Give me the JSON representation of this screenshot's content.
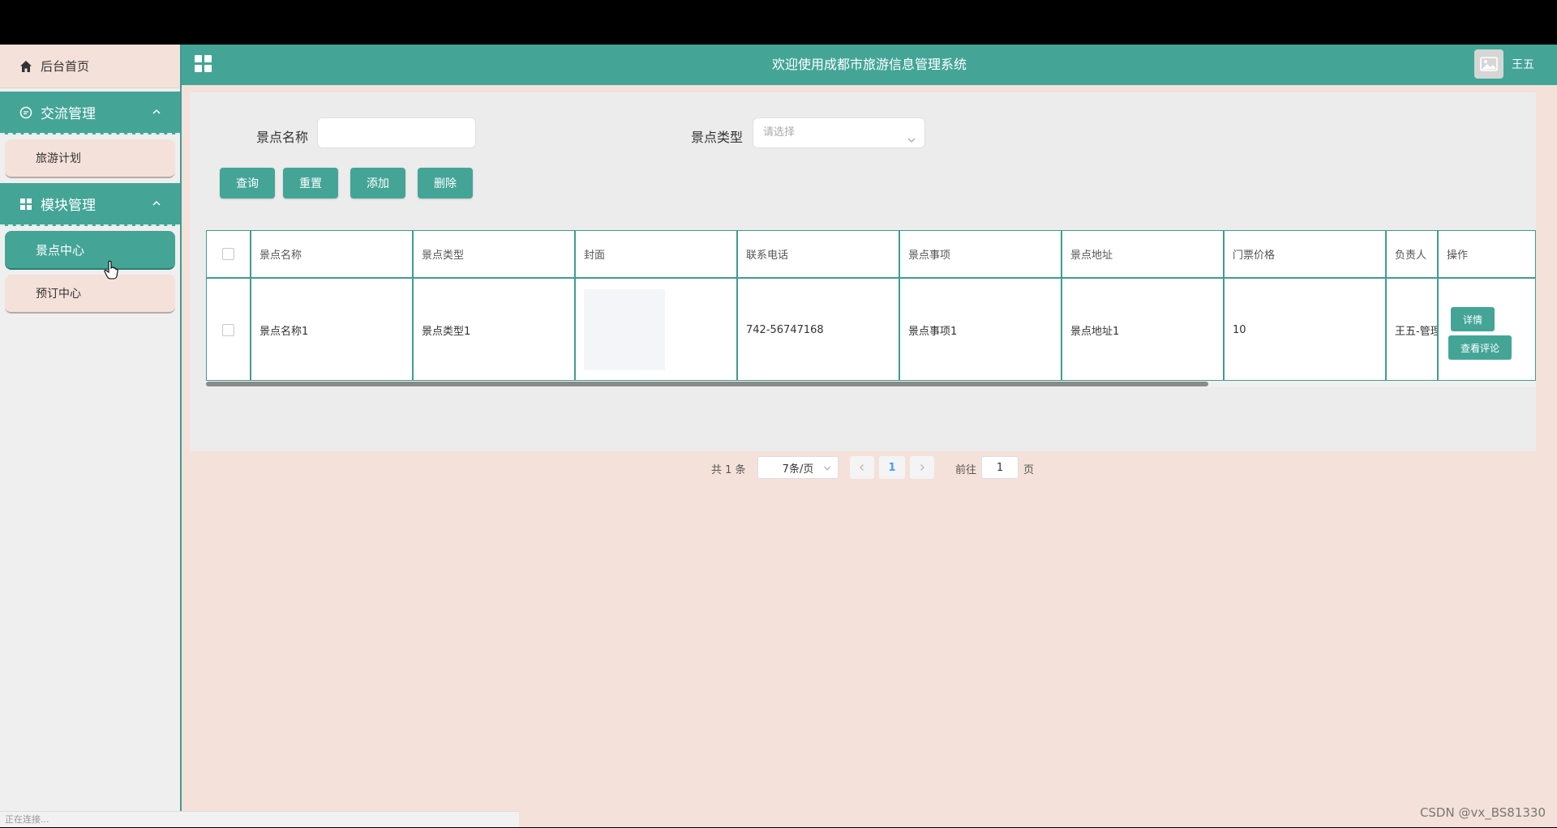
{
  "sidebar": {
    "home_label": "后台首页",
    "groups": [
      {
        "label": "交流管理",
        "items": [
          {
            "label": "旅游计划"
          }
        ]
      },
      {
        "label": "模块管理",
        "items": [
          {
            "label": "景点中心",
            "active": true
          },
          {
            "label": "预订中心"
          }
        ]
      }
    ]
  },
  "header": {
    "title": "欢迎使用成都市旅游信息管理系统",
    "username": "王五"
  },
  "search": {
    "name_label": "景点名称",
    "name_value": "",
    "type_label": "景点类型",
    "type_placeholder": "请选择"
  },
  "buttons": {
    "query": "查询",
    "reset": "重置",
    "add": "添加",
    "delete": "删除"
  },
  "table": {
    "headers": [
      "景点名称",
      "景点类型",
      "封面",
      "联系电话",
      "景点事项",
      "景点地址",
      "门票价格",
      "负责人",
      "操作"
    ],
    "rows": [
      {
        "name": "景点名称1",
        "type": "景点类型1",
        "phone": "742-56747168",
        "item": "景点事项1",
        "address": "景点地址1",
        "price": "10",
        "owner": "王五-管理",
        "detail_label": "详情",
        "review_label": "查看评论"
      }
    ]
  },
  "pagination": {
    "total": "共 1 条",
    "page_size": "7条/页",
    "current_page": "1",
    "goto_prefix": "前往",
    "goto_value": "1",
    "goto_suffix": "页"
  },
  "status_text": "正在连接...",
  "watermark": "CSDN @vx_BS81330",
  "colors": {
    "accent": "#44a597",
    "background": "#f4e1da",
    "panel": "#ececec"
  }
}
